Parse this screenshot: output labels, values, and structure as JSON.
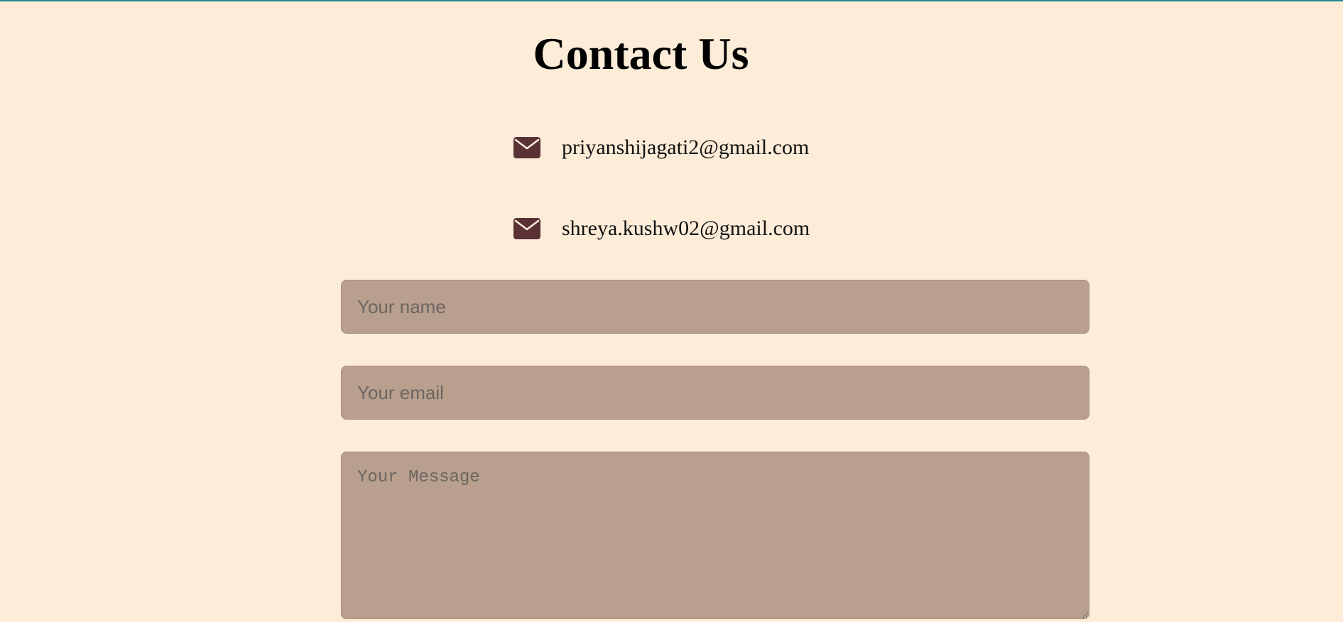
{
  "page": {
    "title": "Contact Us"
  },
  "contacts": [
    {
      "icon": "envelope-icon",
      "email": "priyanshijagati2@gmail.com"
    },
    {
      "icon": "envelope-icon",
      "email": "shreya.kushw02@gmail.com"
    }
  ],
  "form": {
    "name_placeholder": "Your name",
    "email_placeholder": "Your email",
    "message_placeholder": "Your Message"
  },
  "colors": {
    "background": "#fcecd8",
    "field_background": "#b99f8e",
    "icon": "#5a3235",
    "top_border": "#1f8a8f"
  }
}
